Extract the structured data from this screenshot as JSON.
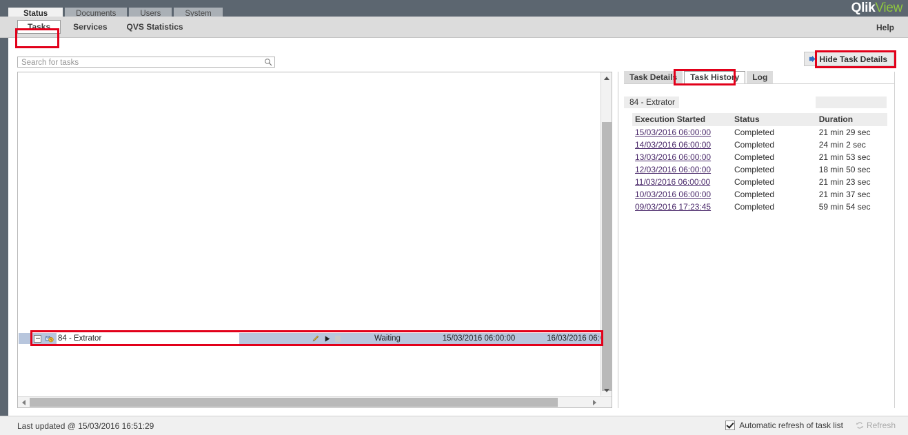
{
  "app": {
    "brand_primary": "Qlik",
    "brand_secondary": "View",
    "brand_color_primary": "#ffffff",
    "brand_color_secondary": "#8ec63f"
  },
  "main_tabs": [
    {
      "label": "Status",
      "active": true
    },
    {
      "label": "Documents",
      "active": false
    },
    {
      "label": "Users",
      "active": false
    },
    {
      "label": "System",
      "active": false
    }
  ],
  "sub_nav": {
    "items": [
      {
        "label": "Tasks",
        "active": true
      },
      {
        "label": "Services",
        "active": false
      },
      {
        "label": "QVS Statistics",
        "active": false
      }
    ],
    "help_label": "Help"
  },
  "search": {
    "placeholder": "Search for tasks",
    "value": "",
    "icon": "search-icon"
  },
  "task_list": {
    "row": {
      "expander_icon": "collapse-minus-icon",
      "task_icon": "task-schedule-icon",
      "name": "84 - Extrator",
      "edit_icon": "pencil-icon",
      "run_icon": "play-icon",
      "stop_icon": "stop-icon",
      "status": "Waiting",
      "last_execution": "15/03/2016 06:00:00",
      "next_execution": "16/03/2016 06:00:"
    }
  },
  "details": {
    "hide_button": {
      "label": "Hide Task Details",
      "icon": "arrow-right-icon"
    },
    "tabs": [
      {
        "label": "Task Details",
        "active": false
      },
      {
        "label": "Task History",
        "active": true
      },
      {
        "label": "Log",
        "active": false
      }
    ],
    "selected_task": "84 - Extrator",
    "history": {
      "columns": [
        "Execution Started",
        "Status",
        "Duration"
      ],
      "rows": [
        {
          "execution_started": "15/03/2016 06:00:00",
          "status": "Completed",
          "duration": "21 min 29 sec"
        },
        {
          "execution_started": "14/03/2016 06:00:00",
          "status": "Completed",
          "duration": "24 min 2 sec"
        },
        {
          "execution_started": "13/03/2016 06:00:00",
          "status": "Completed",
          "duration": "21 min 53 sec"
        },
        {
          "execution_started": "12/03/2016 06:00:00",
          "status": "Completed",
          "duration": "18 min 50 sec"
        },
        {
          "execution_started": "11/03/2016 06:00:00",
          "status": "Completed",
          "duration": "21 min 23 sec"
        },
        {
          "execution_started": "10/03/2016 06:00:00",
          "status": "Completed",
          "duration": "21 min 37 sec"
        },
        {
          "execution_started": "09/03/2016 17:23:45",
          "status": "Completed",
          "duration": "59 min 54 sec"
        }
      ]
    }
  },
  "status_bar": {
    "last_updated": "Last updated @ 15/03/2016 16:51:29",
    "auto_refresh_label": "Automatic refresh of task list",
    "auto_refresh_checked": true,
    "refresh_label": "Refresh",
    "refresh_icon": "refresh-icon",
    "refresh_enabled": false
  },
  "annotations": {
    "highlight_color": "#e2001a",
    "boxes": [
      "tasks-tab",
      "hide-task-details",
      "task-history-tab",
      "task-row"
    ]
  }
}
